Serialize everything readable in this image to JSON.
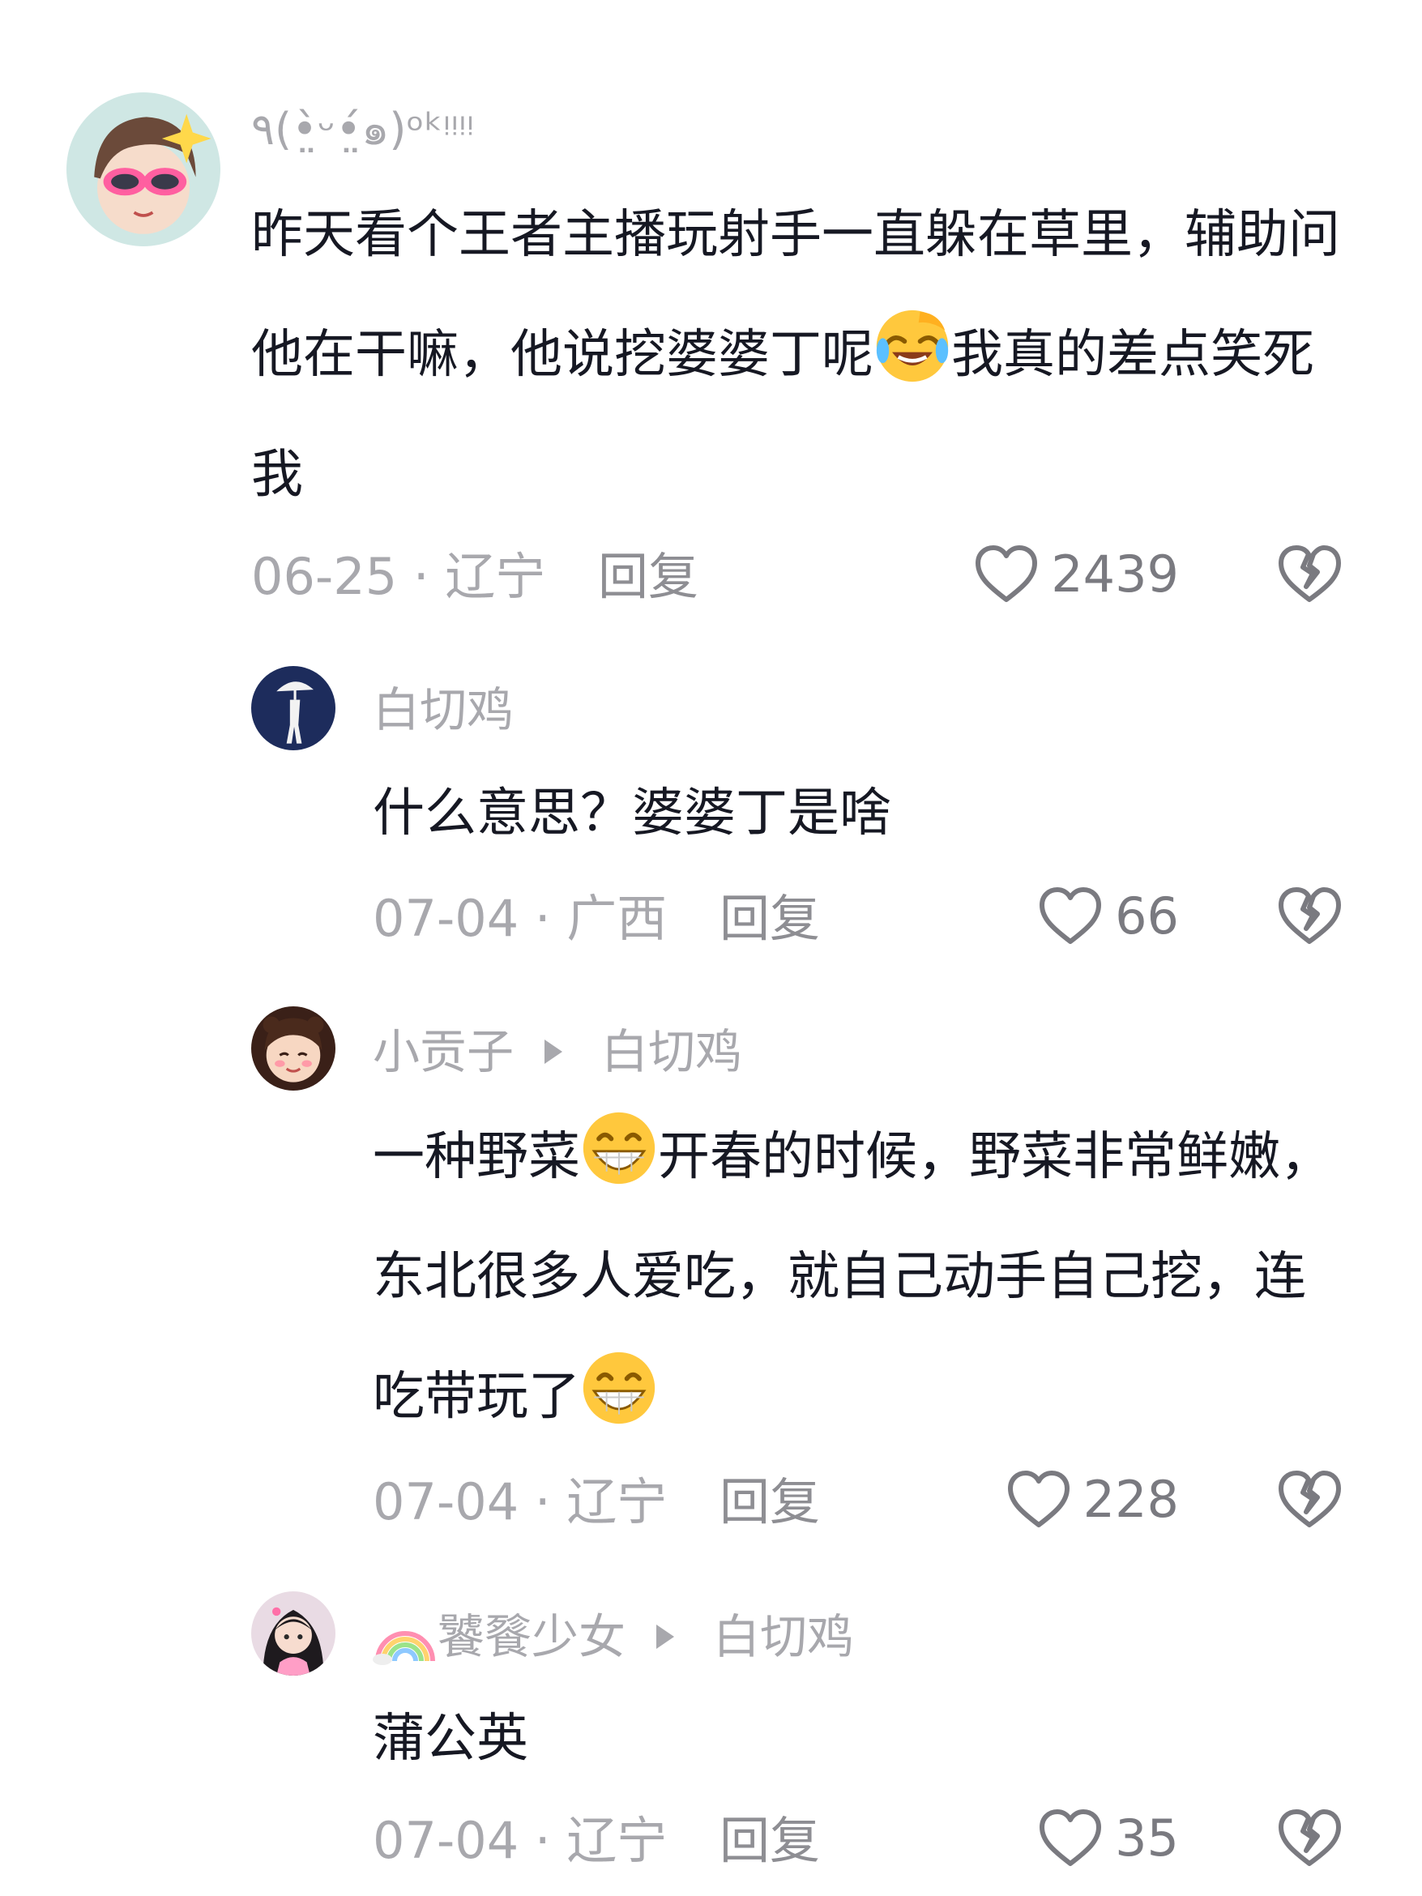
{
  "comments": [
    {
      "author": "٩(•̤̀ᵕ•̤́๑)ᵒᵏᵎᵎᵎᵎ",
      "text_parts": [
        "昨天看个王者主播玩射手一直躲在草里，辅助问他在干嘛，他说挖婆婆丁呢",
        "我真的差点笑死我"
      ],
      "emoji": "laughing-crying",
      "date_location": "06-25 · 辽宁",
      "reply_label": "回复",
      "likes": "2439"
    },
    {
      "author": "白切鸡",
      "text": "什么意思？婆婆丁是啥",
      "date_location": "07-04 · 广西",
      "reply_label": "回复",
      "likes": "66"
    },
    {
      "author": "小贡子",
      "reply_to": "白切鸡",
      "text_parts": [
        "一种野菜",
        "开春的时候，野菜非常鲜嫩，东北很多人爱吃，就自己动手自己挖，连吃带玩了"
      ],
      "emoji": "grinning",
      "date_location": "07-04 · 辽宁",
      "reply_label": "回复",
      "likes": "228"
    },
    {
      "author_emoji": "rainbow",
      "author": "饕餮少女",
      "reply_to": "白切鸡",
      "text": "蒲公英",
      "date_location": "07-04 · 辽宁",
      "reply_label": "回复",
      "likes": "35"
    }
  ]
}
